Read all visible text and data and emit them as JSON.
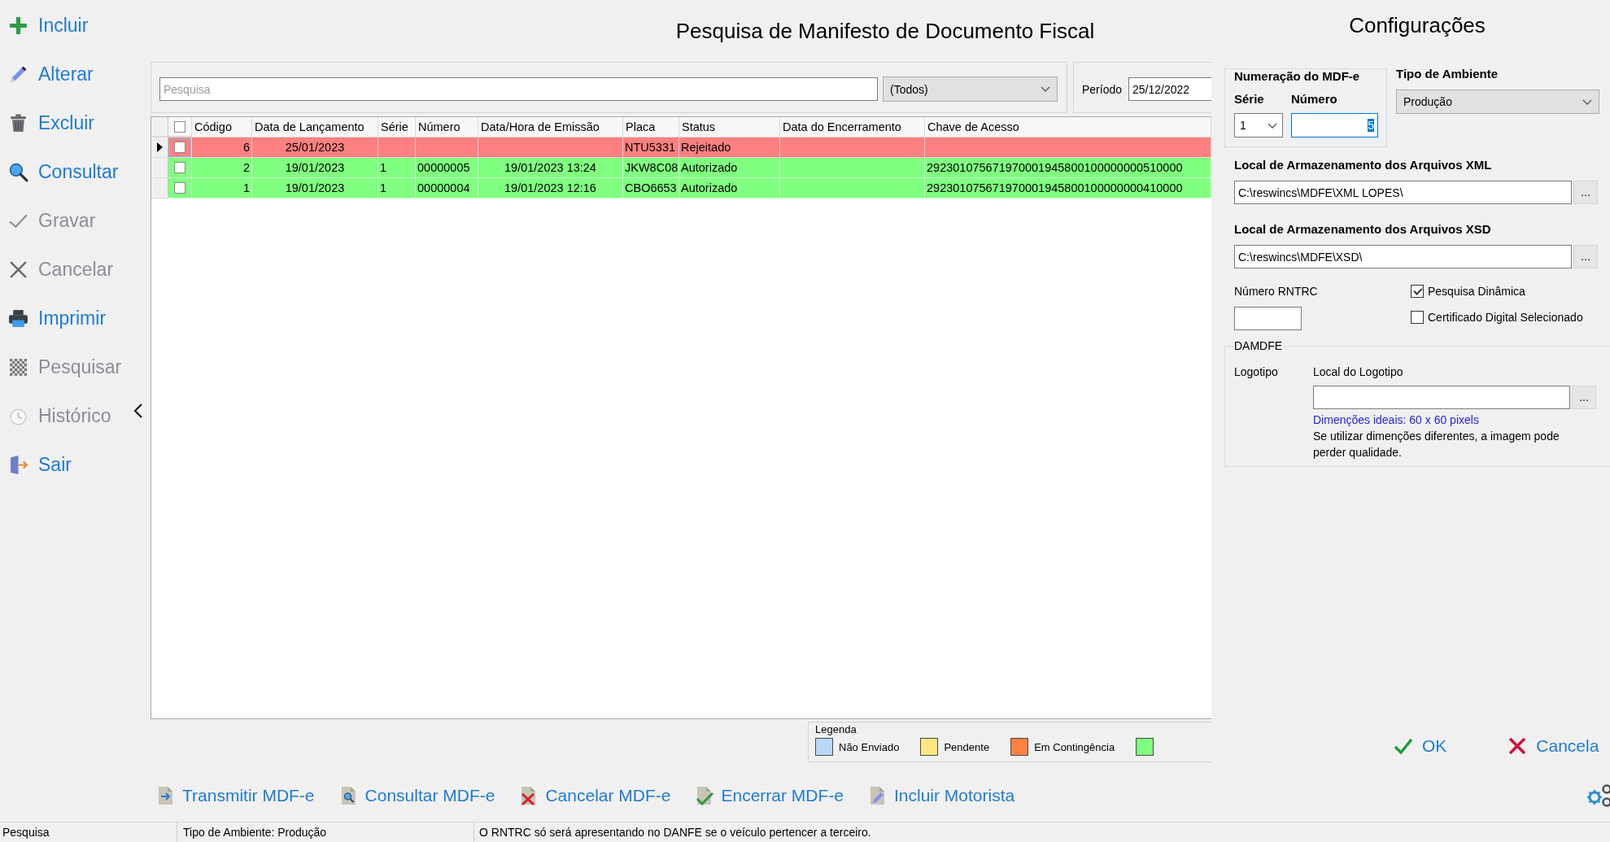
{
  "sidebar": {
    "items": [
      {
        "label": "Incluir",
        "disabled": false
      },
      {
        "label": "Alterar",
        "disabled": false
      },
      {
        "label": "Excluir",
        "disabled": false
      },
      {
        "label": "Consultar",
        "disabled": false
      },
      {
        "label": "Gravar",
        "disabled": true
      },
      {
        "label": "Cancelar",
        "disabled": true
      },
      {
        "label": "Imprimir",
        "disabled": false
      },
      {
        "label": "Pesquisar",
        "disabled": true
      },
      {
        "label": "Histórico",
        "disabled": true
      },
      {
        "label": "Sair",
        "disabled": false
      }
    ]
  },
  "title": "Pesquisa de Manifesto de Documento Fiscal",
  "search": {
    "placeholder": "Pesquisa",
    "filter": "(Todos)"
  },
  "period": {
    "label": "Período",
    "start": "25/12/2022"
  },
  "grid": {
    "select_all_checked": false,
    "columns": [
      "Código",
      "Data de Lançamento",
      "Série",
      "Número",
      "Data/Hora de Emissão",
      "Placa",
      "Status",
      "Data do Encerramento",
      "Chave de Acesso"
    ],
    "rows": [
      {
        "current": true,
        "checked": false,
        "color": "#ff8080",
        "codigo": "6",
        "data_lancamento": "25/01/2023",
        "placa": "NTU5331",
        "status": "Rejeitado"
      },
      {
        "current": false,
        "checked": false,
        "color": "#80ff80",
        "codigo": "2",
        "data_lancamento": "19/01/2023",
        "serie": "1",
        "numero": "00000005",
        "data_hora_emissao": "19/01/2023 13:24",
        "placa": "JKW8C08",
        "status": "Autorizado",
        "chave_acesso": "292301075671970001945800100000000510000"
      },
      {
        "current": false,
        "checked": false,
        "color": "#80ff80",
        "codigo": "1",
        "data_lancamento": "19/01/2023",
        "serie": "1",
        "numero": "00000004",
        "data_hora_emissao": "19/01/2023 12:16",
        "placa": "CBO6653",
        "status": "Autorizado",
        "chave_acesso": "292301075671970001945800100000000410000"
      }
    ]
  },
  "legend": {
    "title": "Legenda",
    "items": [
      {
        "label": "Não Enviado",
        "color": "#b8d8f8"
      },
      {
        "label": "Pendente",
        "color": "#ffe680"
      },
      {
        "label": "Em Contingência",
        "color": "#ff8040"
      },
      {
        "color": "#80ff80"
      }
    ]
  },
  "actions": [
    "Transmitir MDF-e",
    "Consultar MDF-e",
    "Cancelar MDF-e",
    "Encerrar MDF-e",
    "Incluir Motorista"
  ],
  "config": {
    "title": "Configurações",
    "numbering": {
      "title": "Numeração do MDF-e",
      "serie": {
        "label": "Série",
        "value": "1"
      },
      "numero": {
        "label": "Número",
        "value": "5",
        "focused": true
      }
    },
    "environment": {
      "label": "Tipo de Ambiente",
      "value": "Produção"
    },
    "xml_path": {
      "label": "Local de Armazenamento dos Arquivos XML",
      "value": "C:\\reswincs\\MDFE\\XML LOPES\\",
      "browse": "..."
    },
    "xsd_path": {
      "label": "Local de Armazenamento dos Arquivos XSD",
      "value": "C:\\reswincs\\MDFE\\XSD\\",
      "browse": "..."
    },
    "rntrc": {
      "label": "Número RNTRC"
    },
    "options": [
      {
        "label": "Pesquisa Dinâmica",
        "checked": true
      },
      {
        "label": "Certificado Digital Selecionado",
        "checked": false
      }
    ],
    "damdfe": {
      "title": "DAMDFE",
      "logo_label": "Logotipo",
      "path_label": "Local do Logotipo",
      "browse": "...",
      "hint": "Dimenções ideais: 60 x 60 pixels",
      "note": "Se utilizar dimenções diferentes, a imagem pode perder qualidade."
    }
  },
  "dialog_buttons": [
    {
      "kind": "ok",
      "label": "OK"
    },
    {
      "kind": "cancel",
      "label": "Cancela"
    }
  ],
  "status_bar": [
    "Pesquisa",
    "Tipo de Ambiente: Produção",
    "O RNTRC só será apresentando no DANFE se o veículo pertencer a terceiro."
  ]
}
